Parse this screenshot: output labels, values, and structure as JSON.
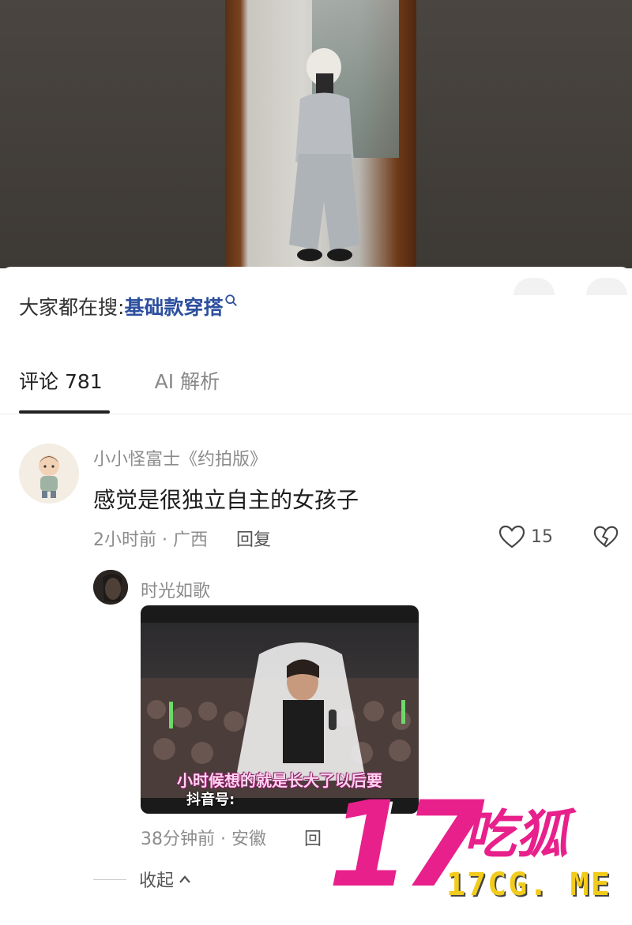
{
  "search_bar": {
    "prefix": "大家都在搜:",
    "term": "基础款穿搭"
  },
  "tabs": [
    {
      "label": "评论 781",
      "active": true
    },
    {
      "label": "AI 解析",
      "active": false
    }
  ],
  "comment": {
    "username": "小小怪富士《约拍版》",
    "text": "感觉是很独立自主的女孩子",
    "time_location": "2小时前 · 广西",
    "reply_label": "回复",
    "like_count": "15"
  },
  "reply": {
    "username": "时光如歌",
    "video_caption": "小时候想的就是长大了以后要",
    "video_watermark": "抖音号:",
    "time_location": "38分钟前 · 安徽",
    "reply_label": "回"
  },
  "collapse_label": "收起",
  "watermark": {
    "number": "17",
    "brand": "吃狐",
    "url": "17CG. ME"
  },
  "colors": {
    "accent_link": "#2d4f9e",
    "watermark_pink": "#e8208c",
    "watermark_yellow": "#f2cc1c"
  }
}
